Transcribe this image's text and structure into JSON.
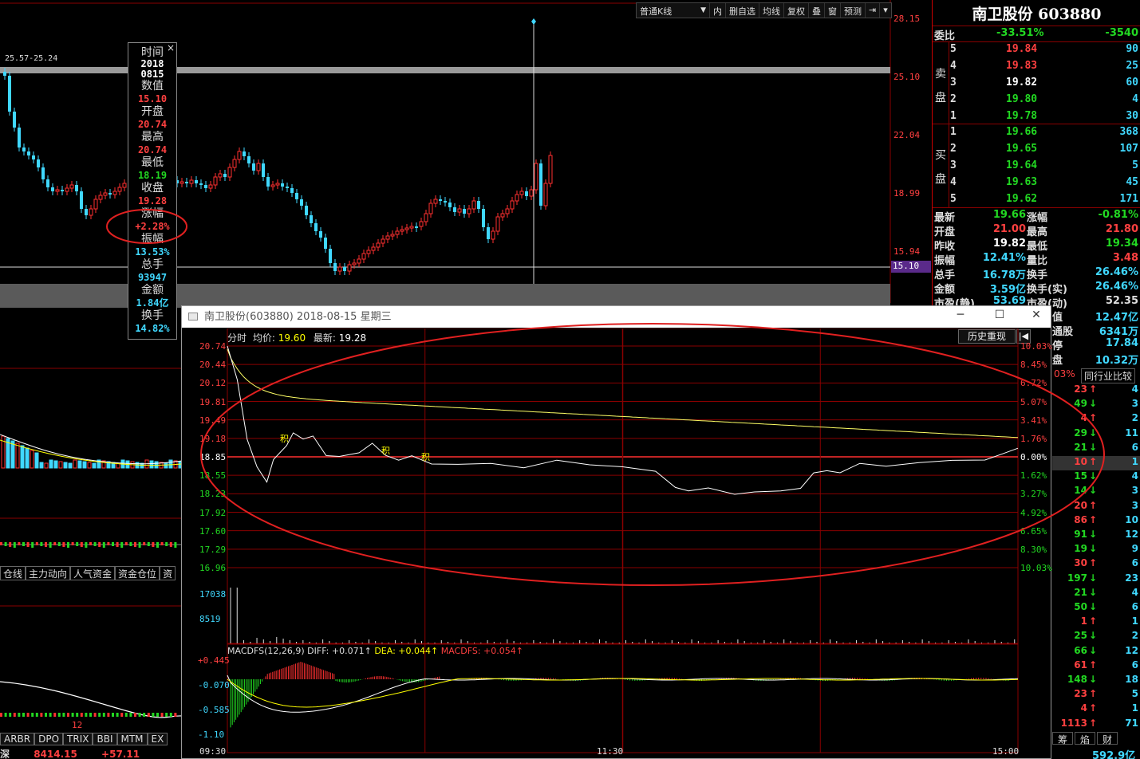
{
  "toolbar": {
    "kline_type": "普通K线",
    "buttons": [
      "内",
      "删自选",
      "均线",
      "复权",
      "叠",
      "窗",
      "预测"
    ]
  },
  "kline": {
    "range_label": "25.57-25.24",
    "price_axis": [
      "28.15",
      "25.10",
      "22.04",
      "18.99",
      "15.94",
      "15.10"
    ]
  },
  "tooltip": {
    "time_label": "时间",
    "date_year": "2018",
    "date_md": "0815",
    "value_label": "数值",
    "value": "15.10",
    "open_label": "开盘",
    "open": "20.74",
    "high_label": "最高",
    "high": "20.74",
    "low_label": "最低",
    "low": "18.19",
    "close_label": "收盘",
    "close": "19.28",
    "change_label": "涨幅",
    "change": "+2.28%",
    "amplitude_label": "振幅",
    "amplitude": "13.53%",
    "volume_label": "总手",
    "volume": "93947",
    "amount_label": "金额",
    "amount": "1.84亿",
    "turnover_label": "换手",
    "turnover": "14.82%"
  },
  "quote": {
    "title": "南卫股份 603880",
    "weibi_label": "委比",
    "weibi": "-33.51%",
    "weicha": "-3540",
    "sell_label": [
      "卖",
      "盘"
    ],
    "buy_label": [
      "买",
      "盘"
    ],
    "asks": [
      {
        "level": "5",
        "price": "19.84",
        "vol": "90"
      },
      {
        "level": "4",
        "price": "19.83",
        "vol": "25"
      },
      {
        "level": "3",
        "price": "19.82",
        "vol": "60"
      },
      {
        "level": "2",
        "price": "19.80",
        "vol": "4"
      },
      {
        "level": "1",
        "price": "19.78",
        "vol": "30"
      }
    ],
    "bids": [
      {
        "level": "1",
        "price": "19.66",
        "vol": "368"
      },
      {
        "level": "2",
        "price": "19.65",
        "vol": "107"
      },
      {
        "level": "3",
        "price": "19.64",
        "vol": "5"
      },
      {
        "level": "4",
        "price": "19.63",
        "vol": "45"
      },
      {
        "level": "5",
        "price": "19.62",
        "vol": "171"
      }
    ],
    "stats": [
      {
        "l1": "最新",
        "v1": "19.66",
        "l2": "涨幅",
        "v2": "-0.81%"
      },
      {
        "l1": "开盘",
        "v1": "21.00",
        "l2": "最高",
        "v2": "21.80"
      },
      {
        "l1": "昨收",
        "v1": "19.82",
        "l2": "最低",
        "v2": "19.34"
      },
      {
        "l1": "振幅",
        "v1": "12.41%",
        "l2": "量比",
        "v2": "3.48"
      },
      {
        "l1": "总手",
        "v1": "16.78万",
        "l2": "换手",
        "v2": "26.46%"
      },
      {
        "l1": "金额",
        "v1": "3.59亿",
        "l2": "换手(实)",
        "v2": "26.46%"
      },
      {
        "l1": "市盈(静)",
        "v1": "53.69",
        "l2": "市盈(动)",
        "v2": "52.35"
      }
    ],
    "partial_stats": [
      {
        "l": "值",
        "v": "12.47亿"
      },
      {
        "l": "通股",
        "v": "6341万"
      },
      {
        "l": "停",
        "v": "17.84"
      },
      {
        "l": "盘",
        "v": "10.32万"
      }
    ],
    "peer_pct": "03%",
    "peer_label": "同行业比较",
    "peer_rows": [
      {
        "a": "23",
        "d": "up",
        "b": "4"
      },
      {
        "a": "49",
        "d": "down",
        "b": "3"
      },
      {
        "a": "4",
        "d": "up",
        "b": "2"
      },
      {
        "a": "29",
        "d": "down",
        "b": "11"
      },
      {
        "a": "21",
        "d": "down",
        "b": "6"
      },
      {
        "a": "10",
        "d": "up",
        "b": "1"
      },
      {
        "a": "15",
        "d": "down",
        "b": "4"
      },
      {
        "a": "14",
        "d": "down",
        "b": "3"
      },
      {
        "a": "20",
        "d": "up",
        "b": "3"
      },
      {
        "a": "86",
        "d": "up",
        "b": "10"
      },
      {
        "a": "91",
        "d": "down",
        "b": "12"
      },
      {
        "a": "19",
        "d": "down",
        "b": "9"
      },
      {
        "a": "30",
        "d": "up",
        "b": "6"
      },
      {
        "a": "197",
        "d": "down",
        "b": "23"
      },
      {
        "a": "21",
        "d": "down",
        "b": "4"
      },
      {
        "a": "50",
        "d": "down",
        "b": "6"
      },
      {
        "a": "1",
        "d": "up",
        "b": "1"
      },
      {
        "a": "25",
        "d": "down",
        "b": "2"
      },
      {
        "a": "66",
        "d": "down",
        "b": "12"
      },
      {
        "a": "61",
        "d": "up",
        "b": "6"
      },
      {
        "a": "148",
        "d": "down",
        "b": "18"
      },
      {
        "a": "23",
        "d": "up",
        "b": "5"
      },
      {
        "a": "4",
        "d": "up",
        "b": "1"
      },
      {
        "a": "1113",
        "d": "up",
        "b": "71"
      }
    ],
    "bottom_tabs": [
      "筹",
      "焰",
      "财"
    ],
    "bottom_value": "592.9亿"
  },
  "popup": {
    "title": "南卫股份(603880) 2018-08-15 星期三",
    "header_fenshi": "分时",
    "header_avg_label": "均价:",
    "header_avg": "19.60",
    "header_last_label": "最新:",
    "header_last": "19.28",
    "history_button": "历史重现",
    "history_icon": "|◀",
    "price_axis": [
      "20.74",
      "20.44",
      "20.12",
      "19.81",
      "19.49",
      "19.18",
      "18.85",
      "18.55",
      "18.23",
      "17.92",
      "17.60",
      "17.29",
      "16.96"
    ],
    "pct_axis": [
      "10.03%",
      "8.45%",
      "6.72%",
      "5.07%",
      "3.41%",
      "1.76%",
      "0.00%",
      "1.62%",
      "3.27%",
      "4.92%",
      "6.65%",
      "8.30%",
      "10.03%"
    ],
    "vol_axis": [
      "17038",
      "8519"
    ],
    "macd_label": "MACDFS(12,26,9)",
    "macd_diff": "DIFF: +0.071↑",
    "macd_dea": "DEA: +0.044↑",
    "macd_fs": "MACDFS: +0.054↑",
    "macd_axis": [
      "+0.445",
      "-0.070",
      "-0.585",
      "-1.10"
    ],
    "time_axis": [
      "09:30",
      "11:30",
      "15:00"
    ],
    "mark_char": "积"
  },
  "left": {
    "tabs": [
      "仓线",
      "主力动向",
      "人气资金",
      "资金仓位",
      "资"
    ],
    "tabs2": [
      "ARBR",
      "DPO",
      "TRIX",
      "BBI",
      "MTM",
      "EX"
    ],
    "sub_label": "12",
    "bottom_prefix": "深",
    "bottom_index": "8414.15",
    "bottom_change": "+57.11"
  },
  "colors": {
    "up": "#ff3030",
    "down": "#22d822",
    "cyan": "#40d8ff",
    "grid": "#8a0000",
    "annotation": "#e02020"
  },
  "icons": [
    "minimize-icon",
    "maximize-icon",
    "close-icon",
    "dropdown-icon",
    "arrow-up-icon",
    "arrow-down-icon"
  ]
}
